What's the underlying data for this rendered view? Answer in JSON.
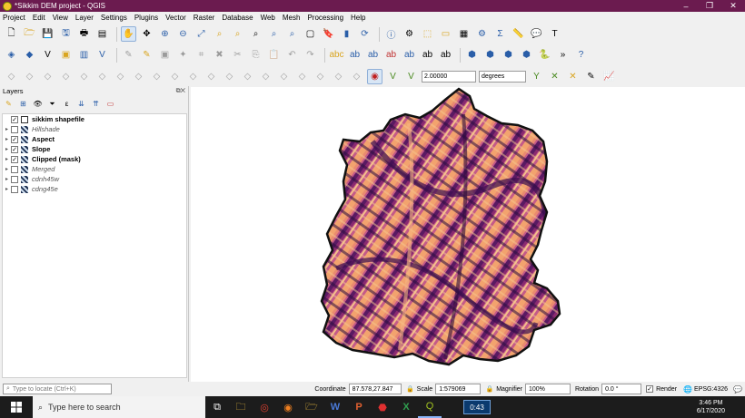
{
  "window": {
    "title": "*Sikkim DEM project - QGIS"
  },
  "menu": [
    "Project",
    "Edit",
    "View",
    "Layer",
    "Settings",
    "Plugins",
    "Vector",
    "Raster",
    "Database",
    "Web",
    "Mesh",
    "Processing",
    "Help"
  ],
  "digitizing": {
    "tolerance_value": "2.00000",
    "tolerance_unit": "degrees"
  },
  "layers_panel": {
    "title": "Layers",
    "items": [
      {
        "name": "sikkim shapefile",
        "checked": true,
        "style": "bold",
        "type": "vector"
      },
      {
        "name": "Hillshade",
        "checked": false,
        "style": "italic",
        "type": "raster"
      },
      {
        "name": "Aspect",
        "checked": true,
        "style": "bold",
        "type": "raster"
      },
      {
        "name": "Slope",
        "checked": true,
        "style": "bold",
        "type": "raster"
      },
      {
        "name": "Clipped (mask)",
        "checked": true,
        "style": "bold",
        "type": "raster"
      },
      {
        "name": "Merged",
        "checked": false,
        "style": "italic",
        "type": "raster"
      },
      {
        "name": "cdnh45w",
        "checked": false,
        "style": "italic",
        "type": "raster"
      },
      {
        "name": "cdng45e",
        "checked": false,
        "style": "italic",
        "type": "raster"
      }
    ]
  },
  "status": {
    "locator_placeholder": "Type to locate (Ctrl+K)",
    "coordinate_label": "Coordinate",
    "coordinate": "87.578,27.847",
    "scale_label": "Scale",
    "scale": "1:579069",
    "magnifier_label": "Magnifier",
    "magnifier": "100%",
    "rotation_label": "Rotation",
    "rotation": "0.0 °",
    "render_label": "Render",
    "crs": "EPSG:4326"
  },
  "taskbar": {
    "search_placeholder": "Type here to search",
    "timer": "0:43",
    "time": "3:46 PM",
    "date": "6/17/2020"
  },
  "colors": {
    "titlebar": "#6b1b4f",
    "terrain_dark": "#3a1050",
    "terrain_mid": "#b0357a",
    "terrain_light": "#f0a070"
  }
}
